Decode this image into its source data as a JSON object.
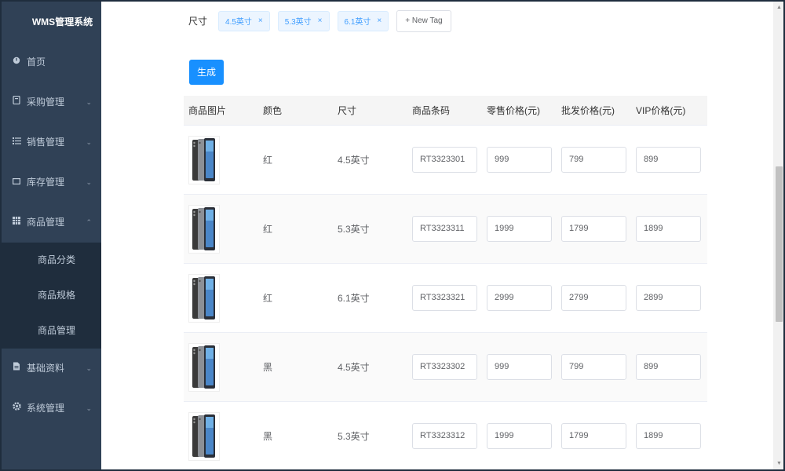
{
  "app": {
    "title": "WMS管理系统"
  },
  "sidebar": {
    "items": [
      {
        "label": "首页",
        "icon": "dashboard-icon",
        "arrow": ""
      },
      {
        "label": "采购管理",
        "icon": "purchase-icon",
        "arrow": "⌄"
      },
      {
        "label": "销售管理",
        "icon": "list-icon",
        "arrow": "⌄"
      },
      {
        "label": "库存管理",
        "icon": "inventory-icon",
        "arrow": "⌄"
      },
      {
        "label": "商品管理",
        "icon": "grid-icon",
        "arrow": "⌃"
      }
    ],
    "submenu": [
      {
        "label": "商品分类"
      },
      {
        "label": "商品规格"
      },
      {
        "label": "商品管理"
      }
    ],
    "items_after": [
      {
        "label": "基础资料",
        "icon": "document-icon",
        "arrow": "⌄"
      },
      {
        "label": "系统管理",
        "icon": "gear-icon",
        "arrow": "⌄"
      }
    ]
  },
  "size_row": {
    "label": "尺寸",
    "tags": [
      "4.5英寸",
      "5.3英寸",
      "6.1英寸"
    ],
    "tag_close": "×",
    "new_tag": "+ New Tag"
  },
  "generate_button": "生成",
  "table": {
    "headers": [
      "商品图片",
      "颜色",
      "尺寸",
      "商品条码",
      "零售价格(元)",
      "批发价格(元)",
      "VIP价格(元)"
    ],
    "rows": [
      {
        "color": "红",
        "size": "4.5英寸",
        "barcode": "RT3323301",
        "retail": "999",
        "wholesale": "799",
        "vip": "899"
      },
      {
        "color": "红",
        "size": "5.3英寸",
        "barcode": "RT3323311",
        "retail": "1999",
        "wholesale": "1799",
        "vip": "1899"
      },
      {
        "color": "红",
        "size": "6.1英寸",
        "barcode": "RT3323321",
        "retail": "2999",
        "wholesale": "2799",
        "vip": "2899"
      },
      {
        "color": "黑",
        "size": "4.5英寸",
        "barcode": "RT3323302",
        "retail": "999",
        "wholesale": "799",
        "vip": "899"
      },
      {
        "color": "黑",
        "size": "5.3英寸",
        "barcode": "RT3323312",
        "retail": "1999",
        "wholesale": "1799",
        "vip": "1899"
      }
    ]
  },
  "colors": {
    "sidebar_bg": "#304156",
    "submenu_bg": "#1f2d3d",
    "primary": "#1890ff",
    "tag_bg": "#ecf5ff"
  }
}
